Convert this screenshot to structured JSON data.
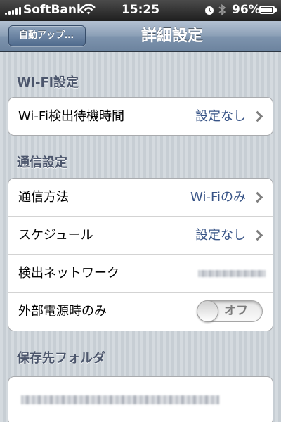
{
  "status_bar": {
    "carrier": "SoftBank",
    "time": "15:25",
    "battery_percent": "96%",
    "battery_level": 0.96,
    "icons": [
      "signal-icon",
      "wifi-icon",
      "alarm-icon",
      "bluetooth-icon",
      "battery-icon"
    ]
  },
  "nav": {
    "back_label": "自動アップ…",
    "title": "詳細設定"
  },
  "wifi_section": {
    "header": "Wi-Fi設定",
    "rows": [
      {
        "label": "Wi-Fi検出待機時間",
        "value": "設定なし"
      }
    ]
  },
  "comm_section": {
    "header": "通信設定",
    "rows": [
      {
        "label": "通信方法",
        "value": "Wi-Fiのみ"
      },
      {
        "label": "スケジュール",
        "value": "設定なし"
      },
      {
        "label": "検出ネットワーク"
      },
      {
        "label": "外部電源時のみ",
        "toggle": "オフ",
        "toggle_on": false
      }
    ]
  },
  "folder_section": {
    "header": "保存先フォルダ"
  },
  "colors": {
    "value_text": "#385487",
    "section_header": "#4c566c",
    "nav_bar": "#7e94ae"
  }
}
